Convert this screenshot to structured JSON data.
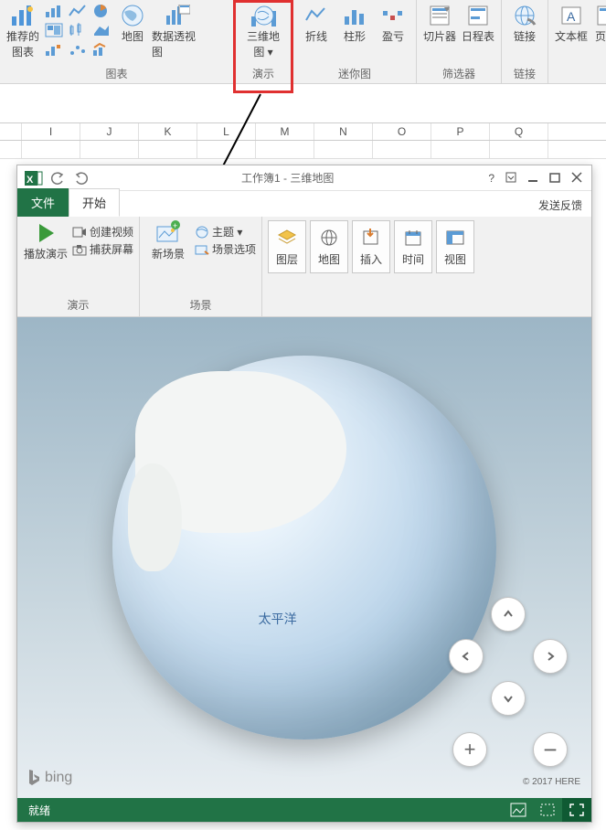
{
  "excel_ribbon": {
    "groups": {
      "charts": {
        "label": "图表",
        "recommended": "推荐的\n图表",
        "map": "地图",
        "pivot": "数据透视图"
      },
      "demo": {
        "label": "演示",
        "threeDMap": "三维地\n图 ▾"
      },
      "sparklines": {
        "label": "迷你图",
        "line": "折线",
        "column": "柱形",
        "winloss": "盈亏"
      },
      "filters": {
        "label": "筛选器",
        "slicer": "切片器",
        "timeline": "日程表"
      },
      "links": {
        "label": "链接",
        "link": "链接"
      },
      "text": {
        "textbox": "文本框",
        "header": "页眉"
      }
    }
  },
  "columns": [
    "I",
    "J",
    "K",
    "L",
    "M",
    "N",
    "O",
    "P",
    "Q"
  ],
  "mapwin": {
    "title": "工作簿1 - 三维地图",
    "tabs": {
      "file": "文件",
      "start": "开始"
    },
    "feedback": "发送反馈",
    "ribbon": {
      "demo": {
        "label": "演示",
        "play": "播放演示",
        "createVideo": "创建视频",
        "captureScreen": "捕获屏幕"
      },
      "scene": {
        "label": "场景",
        "newScene": "新场景",
        "theme": "主题 ▾",
        "sceneOptions": "场景选项"
      },
      "tiles": {
        "layer": "图层",
        "map": "地图",
        "insert": "插入",
        "time": "时间",
        "view": "视图"
      }
    },
    "canvas": {
      "oceanLabel": "太平洋",
      "bing": "bing",
      "attribution": "© 2017 HERE"
    },
    "status": {
      "ready": "就绪"
    }
  }
}
